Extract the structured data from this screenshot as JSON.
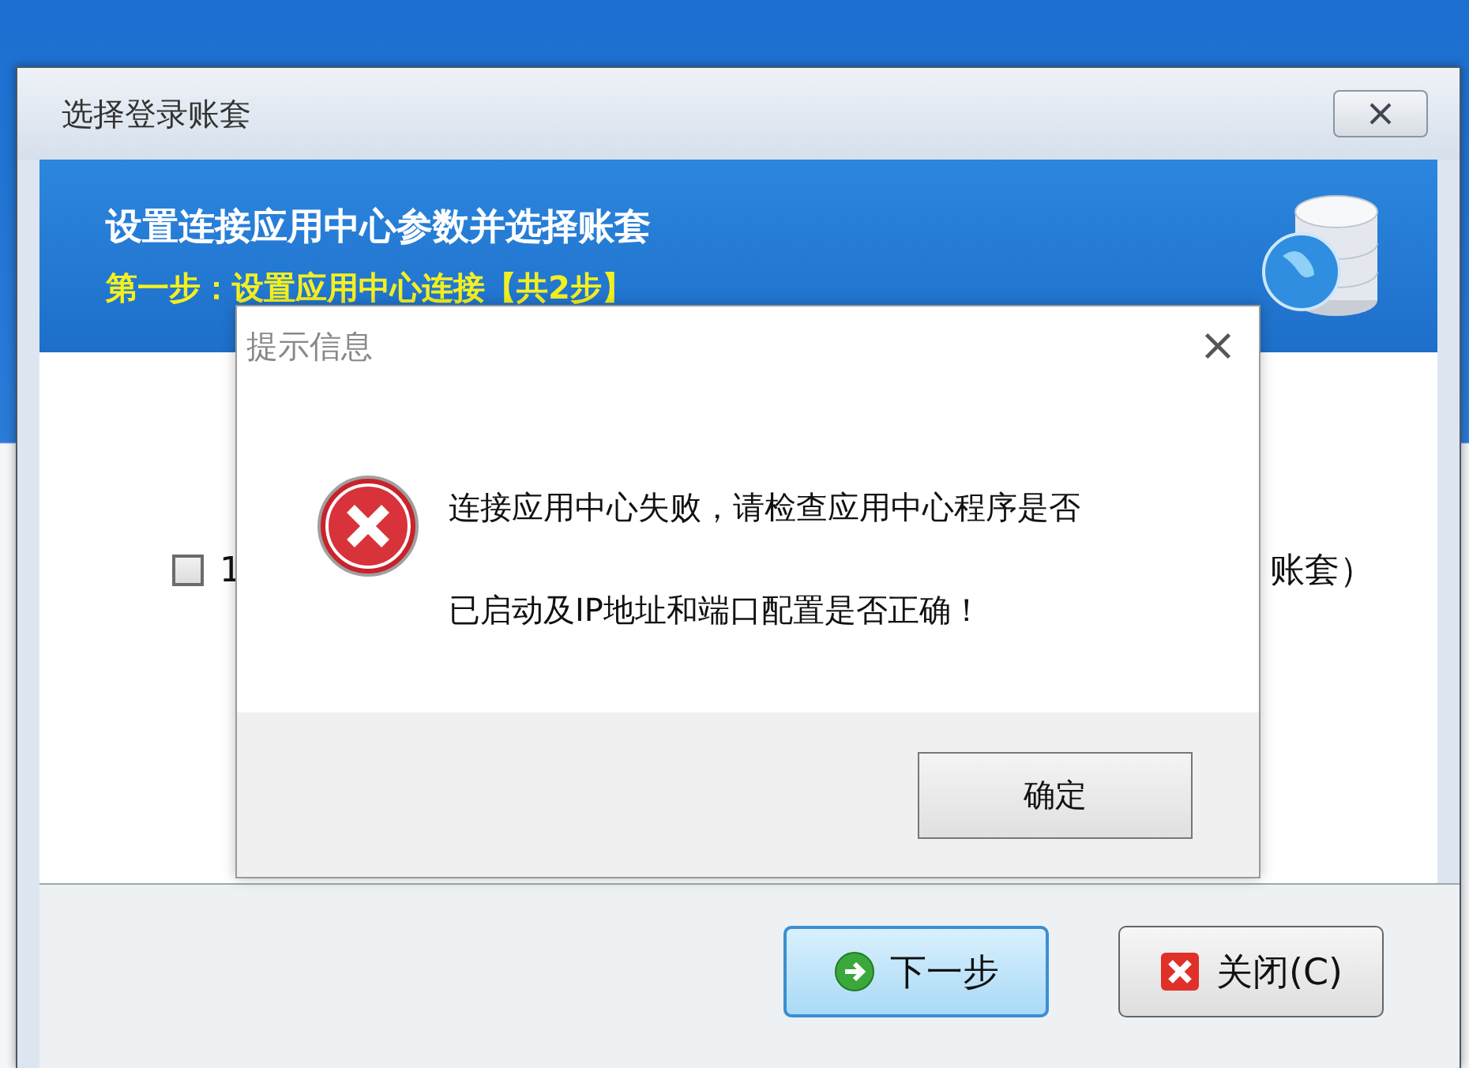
{
  "window": {
    "title": "选择登录账套"
  },
  "banner": {
    "title": "设置连接应用中心参数并选择账套",
    "step": "第一步：设置应用中心连接【共2步】"
  },
  "option": {
    "checked": false,
    "label_start": "1",
    "label_end": "账套）"
  },
  "buttons": [
    {
      "label": "下一步",
      "kind": "next",
      "default": true
    },
    {
      "label": "关闭(C)",
      "kind": "close",
      "default": false
    }
  ],
  "message_box": {
    "title": "提示信息",
    "kind": "error",
    "lines": [
      "连接应用中心失败，请检查应用中心程序是否",
      "已启动及IP地址和端口配置是否正确！"
    ],
    "button": "确定"
  }
}
